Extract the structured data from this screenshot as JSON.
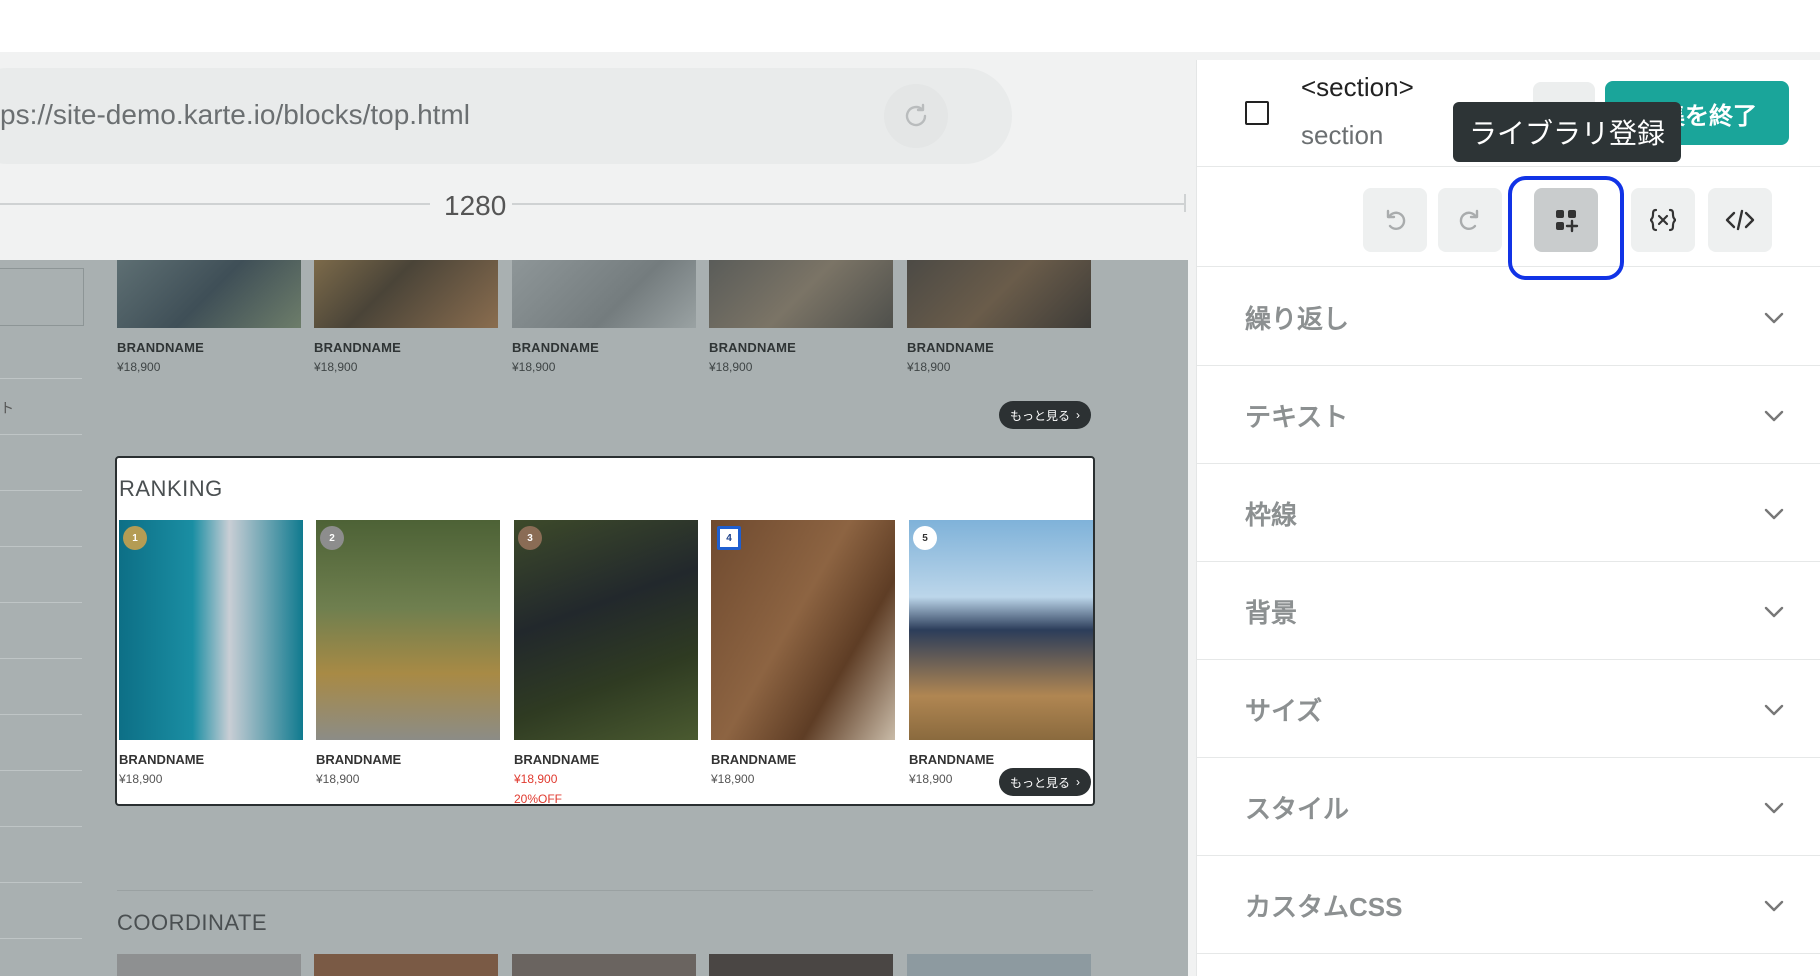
{
  "browser": {
    "url": "ps://site-demo.karte.io/blocks/top.html",
    "viewport_width": "1280"
  },
  "page": {
    "top_products": [
      {
        "brand": "BRANDNAME",
        "price": "¥18,900"
      },
      {
        "brand": "BRANDNAME",
        "price": "¥18,900"
      },
      {
        "brand": "BRANDNAME",
        "price": "¥18,900"
      },
      {
        "brand": "BRANDNAME",
        "price": "¥18,900"
      },
      {
        "brand": "BRANDNAME",
        "price": "¥18,900"
      }
    ],
    "more_label": "もっと見る",
    "sidebar_text": "ト",
    "ranking": {
      "title": "RANKING",
      "items": [
        {
          "rank": "1",
          "brand": "BRANDNAME",
          "price": "¥18,900",
          "off": ""
        },
        {
          "rank": "2",
          "brand": "BRANDNAME",
          "price": "¥18,900",
          "off": ""
        },
        {
          "rank": "3",
          "brand": "BRANDNAME",
          "price": "¥18,900",
          "off": "20%OFF"
        },
        {
          "rank": "4",
          "brand": "BRANDNAME",
          "price": "¥18,900",
          "off": ""
        },
        {
          "rank": "5",
          "brand": "BRANDNAME",
          "price": "¥18,900",
          "off": ""
        }
      ],
      "more_label": "もっと見る"
    },
    "coordinate_title": "COORDINATE"
  },
  "panel": {
    "selected_tag": "<section>",
    "selected_class": "section",
    "finish_label": "編集を終了",
    "tooltip": "ライブラリ登録",
    "accordion": [
      {
        "label": "繰り返し"
      },
      {
        "label": "テキスト"
      },
      {
        "label": "枠線"
      },
      {
        "label": "背景"
      },
      {
        "label": "サイズ"
      },
      {
        "label": "スタイル"
      },
      {
        "label": "カスタムCSS"
      }
    ]
  },
  "colors": {
    "accent": "#1aa59a",
    "highlight": "#1133e6",
    "sale": "#e03a2f"
  }
}
